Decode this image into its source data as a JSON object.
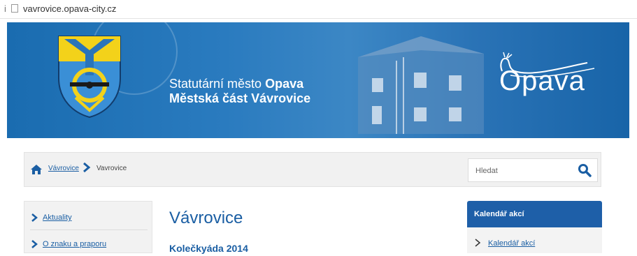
{
  "browser": {
    "url": "vavrovice.opava-city.cz"
  },
  "header": {
    "title_prefix": "Statutární město ",
    "title_city": "Opava",
    "subtitle": "Městská část Vávrovice",
    "logo_word": "Opava"
  },
  "breadcrumb": {
    "link": "Vávrovice",
    "current": "Vavrovice"
  },
  "search": {
    "placeholder": "Hledat"
  },
  "sidebar": {
    "items": [
      {
        "label": "Aktuality"
      },
      {
        "label": "O znaku a praporu"
      }
    ]
  },
  "main": {
    "page_title": "Vávrovice",
    "article_title": "Kolečkyáda 2014"
  },
  "calendar": {
    "heading": "Kalendář akcí",
    "link": "Kalendář akcí"
  },
  "colors": {
    "banner_blue": "#1a6cb0",
    "link_blue": "#1a5ea3",
    "calendar_head": "#1e5fa8"
  }
}
